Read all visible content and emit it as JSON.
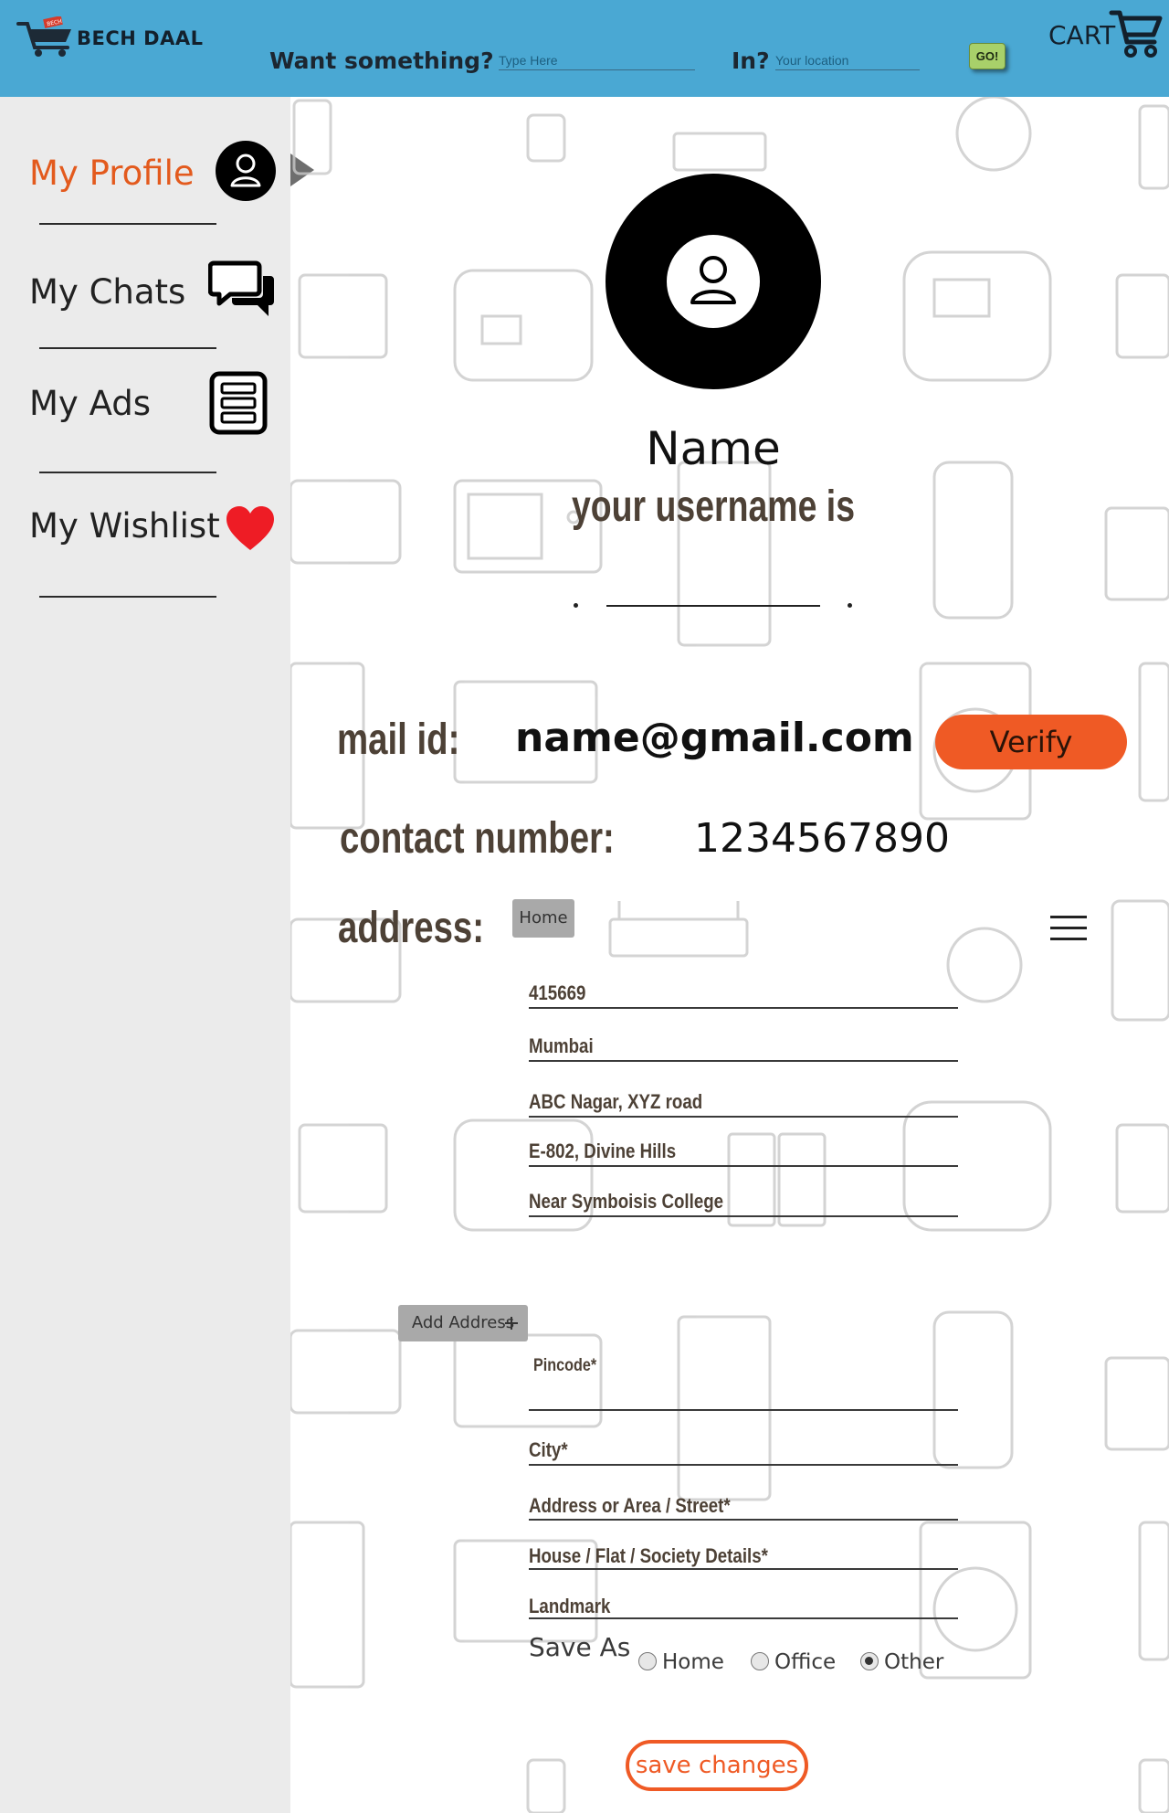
{
  "brand": {
    "name": "BECH DAAL",
    "badge": "BECH"
  },
  "header": {
    "search_label": "Want something?",
    "search_placeholder": "Type Here",
    "location_label": "In?",
    "location_placeholder": "Your location",
    "go_label": "GO!",
    "cart_label": "CART"
  },
  "sidebar": {
    "items": [
      {
        "label": "My Profile",
        "icon": "user-icon",
        "active": true
      },
      {
        "label": "My Chats",
        "icon": "chat-icon",
        "active": false
      },
      {
        "label": "My Ads",
        "icon": "document-icon",
        "active": false
      },
      {
        "label": "My Wishlist",
        "icon": "heart-icon",
        "active": false
      }
    ]
  },
  "profile": {
    "name": "Name",
    "username_label": "your username is",
    "email_label": "mail id:",
    "email": "name@gmail.com",
    "verify_label": "Verify",
    "contact_label": "contact number:",
    "contact": "1234567890",
    "address_label": "address:"
  },
  "saved_address": {
    "tag": "Home",
    "lines": [
      "415669",
      "Mumbai",
      "ABC Nagar, XYZ road",
      "E-802, Divine Hills",
      "Near Symboisis College"
    ]
  },
  "new_address": {
    "add_label": "Add Address",
    "fields": [
      "Pincode*",
      "City*",
      "Address or Area / Street*",
      "House / Flat / Society Details*",
      "Landmark"
    ],
    "save_as_label": "Save As",
    "options": [
      "Home",
      "Office",
      "Other"
    ],
    "selected": "Other"
  },
  "save_label": "save changes",
  "colors": {
    "header": "#4aa8d3",
    "accent": "#ef5a25",
    "sidebar": "#ebebeb",
    "label_brown": "#4d4136"
  }
}
